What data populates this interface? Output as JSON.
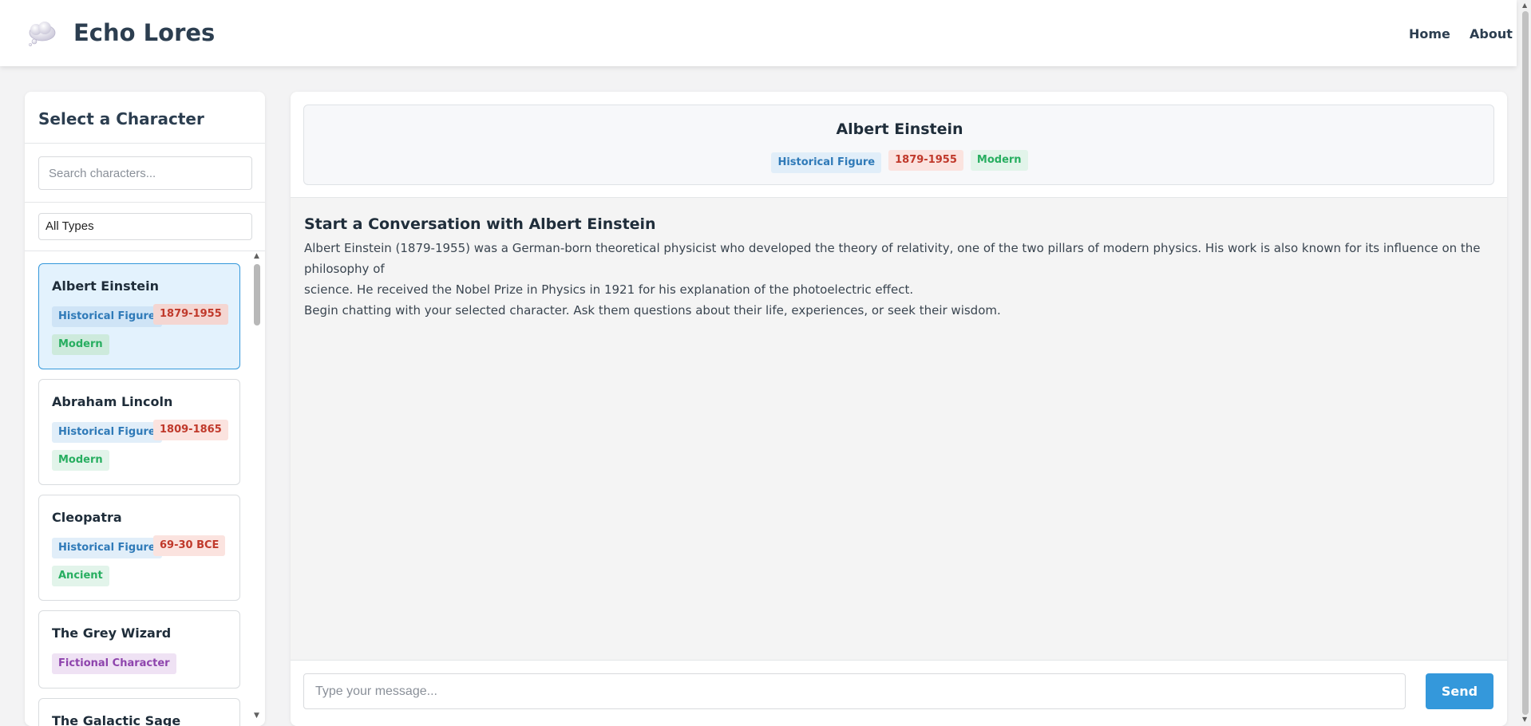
{
  "header": {
    "brand": "Echo Lores",
    "logo_icon": "thought-cloud-icon",
    "nav": [
      {
        "label": "Home"
      },
      {
        "label": "About"
      }
    ]
  },
  "sidebar": {
    "title": "Select a Character",
    "search_placeholder": "Search characters...",
    "filter_selected": "All Types",
    "characters": [
      {
        "name": "Albert Einstein",
        "type": "Historical Figure",
        "dates": "1879-1955",
        "era": "Modern",
        "selected": true
      },
      {
        "name": "Abraham Lincoln",
        "type": "Historical Figure",
        "dates": "1809-1865",
        "era": "Modern"
      },
      {
        "name": "Cleopatra",
        "type": "Historical Figure",
        "dates": "69-30 BCE",
        "era": "Ancient"
      },
      {
        "name": "The Grey Wizard",
        "type": "Fictional Character"
      },
      {
        "name": "The Galactic Sage"
      }
    ]
  },
  "chat": {
    "character_name": "Albert Einstein",
    "badges": {
      "type": "Historical Figure",
      "dates": "1879-1955",
      "era": "Modern"
    },
    "intro_title": "Start a Conversation with Albert Einstein",
    "bio_line1": "Albert Einstein (1879-1955) was a German-born theoretical physicist who developed the theory of relativity, one of the two pillars of modern physics. His work is also known for its influence on the philosophy of",
    "bio_line2": "science. He received the Nobel Prize in Physics in 1921 for his explanation of the photoelectric effect.",
    "hint": "Begin chatting with your selected character. Ask them questions about their life, experiences, or seek their wisdom.",
    "input_placeholder": "Type your message...",
    "send_label": "Send"
  },
  "colors": {
    "accent": "#3498db",
    "text_dark": "#2c3e50",
    "badge_type": "#2f7ab8",
    "badge_fictional": "#8e44ad",
    "badge_dates": "#c0392b",
    "badge_era": "#27ae60",
    "selected_card_bg": "#e3f2fd"
  }
}
